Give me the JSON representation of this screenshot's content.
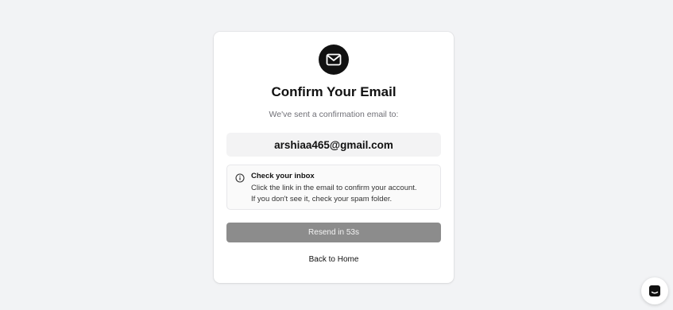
{
  "card": {
    "title": "Confirm Your Email",
    "subtitle": "We've sent a confirmation email to:",
    "email": "arshiaa465@gmail.com",
    "info": {
      "title": "Check your inbox",
      "line1": "Click the link in the email to confirm your account.",
      "line2": "If you don't see it, check your spam folder."
    },
    "resend_label": "Resend in 53s",
    "back_label": "Back to Home"
  },
  "icons": {
    "header": "mail-icon",
    "info": "info-icon",
    "chat": "chat-icon"
  },
  "colors": {
    "page_background": "#f2f3f5",
    "badge": "#111111",
    "resend_disabled": "#8c8c8c"
  }
}
